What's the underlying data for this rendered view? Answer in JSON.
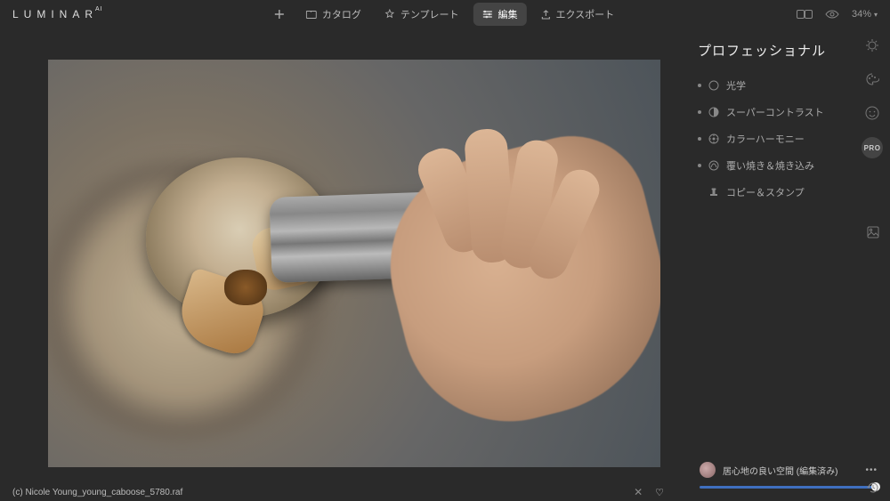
{
  "app": {
    "name": "LUMINAR",
    "suffix": "AI"
  },
  "topnav": {
    "catalog": "カタログ",
    "templates": "テンプレート",
    "edit": "編集",
    "export": "エクスポート"
  },
  "zoom": {
    "value": "34%"
  },
  "panel": {
    "title": "プロフェッショナル",
    "tools": {
      "optics": "光学",
      "supercontrast": "スーパーコントラスト",
      "colorharmony": "カラーハーモニー",
      "dodgeburn": "覆い焼き＆焼き込み",
      "clonedstamp": "コピー＆スタンプ"
    }
  },
  "sidebar": {
    "pro_label": "PRO"
  },
  "preset": {
    "name": "居心地の良い空間 (編集済み)"
  },
  "footer": {
    "filename": "(c) Nicole Young_young_caboose_5780.raf"
  }
}
